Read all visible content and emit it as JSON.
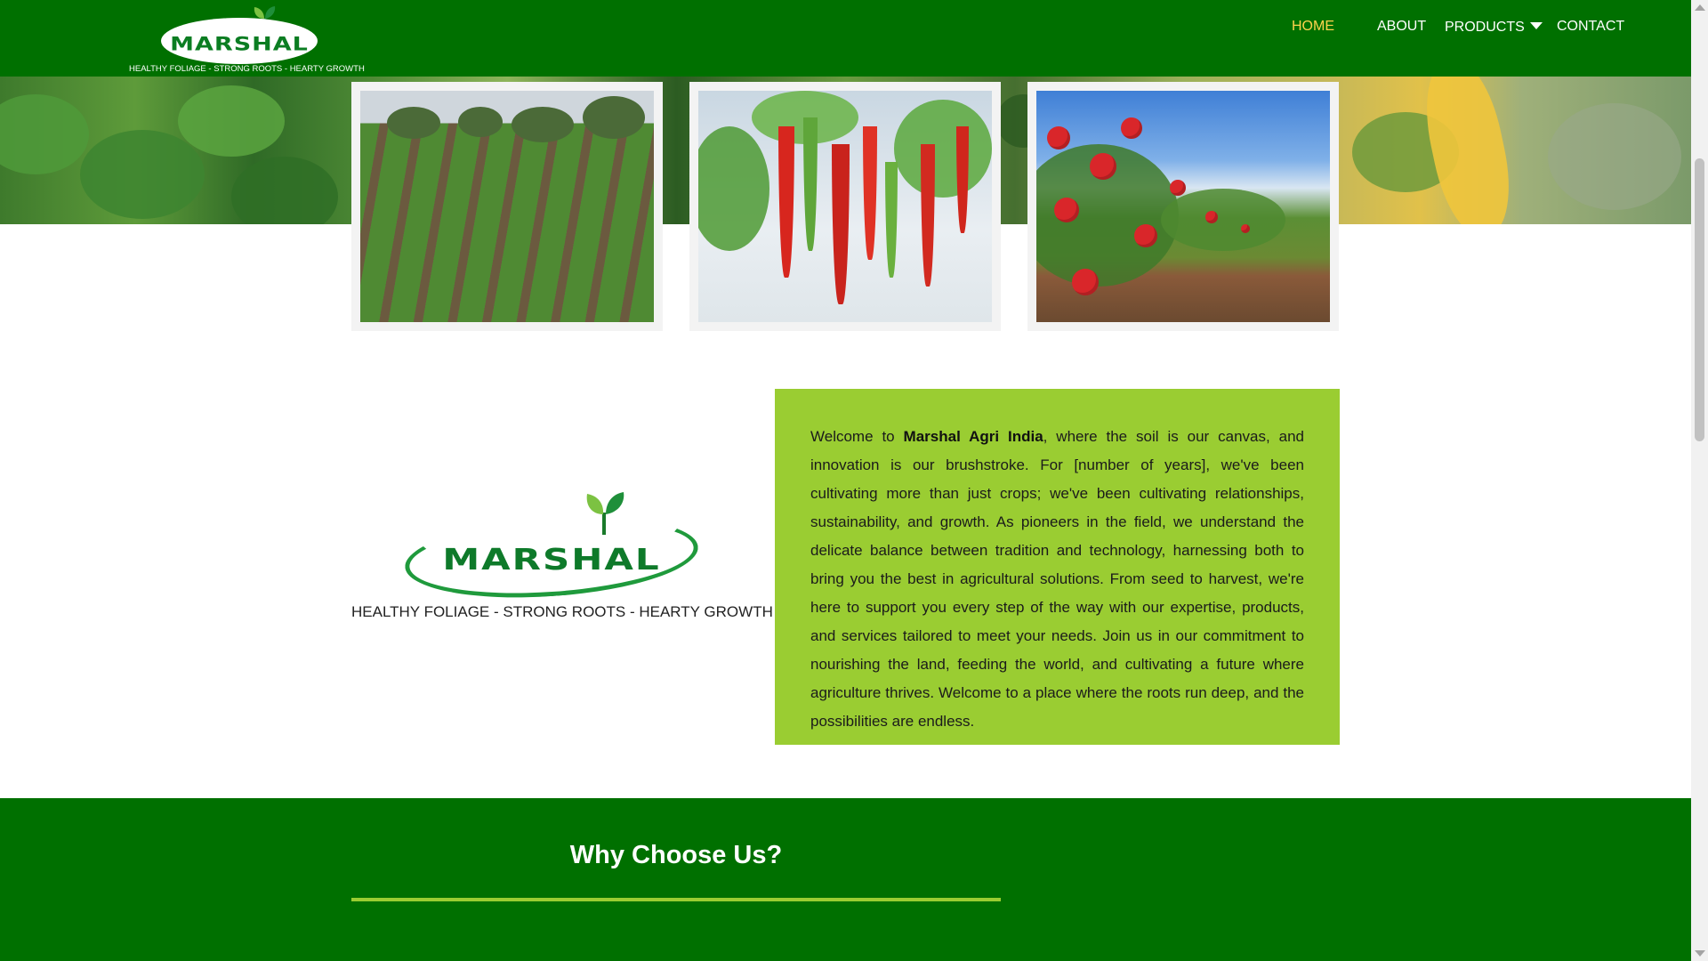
{
  "brand": {
    "name": "MARSHAL",
    "tagline": "HEALTHY FOLIAGE - STRONG ROOTS - HEARTY GROWTH",
    "primary_color": "#007000",
    "accent_color": "#9acd32",
    "active_nav_color": "#ffd34d"
  },
  "nav": {
    "home": "HOME",
    "about": "ABOUT",
    "products": "PRODUCTS",
    "contact": "CONTACT",
    "active": "HOME"
  },
  "gallery": {
    "images": [
      "field-crop-photo",
      "chili-pepper-photo",
      "pomegranate-orchard-photo"
    ]
  },
  "about": {
    "intro": "Welcome to ",
    "company": "Marshal Agri India",
    "body": ", where the soil is our canvas, and innovation is our brushstroke. For [number of years], we've been cultivating more than just crops; we've been cultivating relationships, sustainability, and growth. As pioneers in the field, we understand the delicate balance between tradition and technology, harnessing both to bring you the best in agricultural solutions. From seed to harvest, we're here to support you every step of the way with our expertise, products, and services tailored to meet your needs. Join us in our commitment to nourishing the land, feeding the world, and cultivating a future where agriculture thrives. Welcome to a place where the roots run deep, and the possibilities are endless."
  },
  "why": {
    "title": "Why Choose Us?"
  }
}
